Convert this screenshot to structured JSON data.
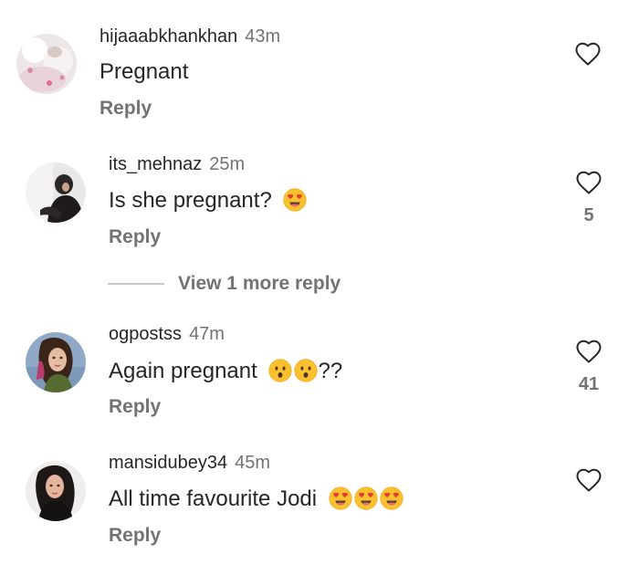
{
  "comments": [
    {
      "username": "hijaaabkhankhan",
      "time": "43m",
      "text": "Pregnant",
      "emojis": [],
      "text_suffix": "",
      "reply_label": "Reply",
      "like_count": ""
    },
    {
      "username": "its_mehnaz",
      "time": "25m",
      "text": "Is she pregnant?",
      "emojis": [
        "heart-eyes-emoji"
      ],
      "text_suffix": "",
      "reply_label": "Reply",
      "like_count": "5",
      "view_more_label": "View 1 more reply"
    },
    {
      "username": "ogpostss",
      "time": "47m",
      "text": "Again pregnant",
      "emojis": [
        "hushed-face-emoji",
        "hushed-face-emoji"
      ],
      "text_suffix": "??",
      "reply_label": "Reply",
      "like_count": "41"
    },
    {
      "username": "mansidubey34",
      "time": "45m",
      "text": "All time favourite Jodi",
      "emojis": [
        "heart-eyes-emoji",
        "heart-eyes-emoji",
        "heart-eyes-emoji"
      ],
      "text_suffix": "",
      "reply_label": "Reply",
      "like_count": ""
    }
  ],
  "icons": {
    "like": "heart-outline-icon",
    "avatar": "user-avatar"
  },
  "colors": {
    "text": "#262626",
    "secondary": "#737373",
    "divider": "#c7c7c7",
    "emoji_face": "#fbc02d",
    "emoji_heart": "#e53935"
  }
}
